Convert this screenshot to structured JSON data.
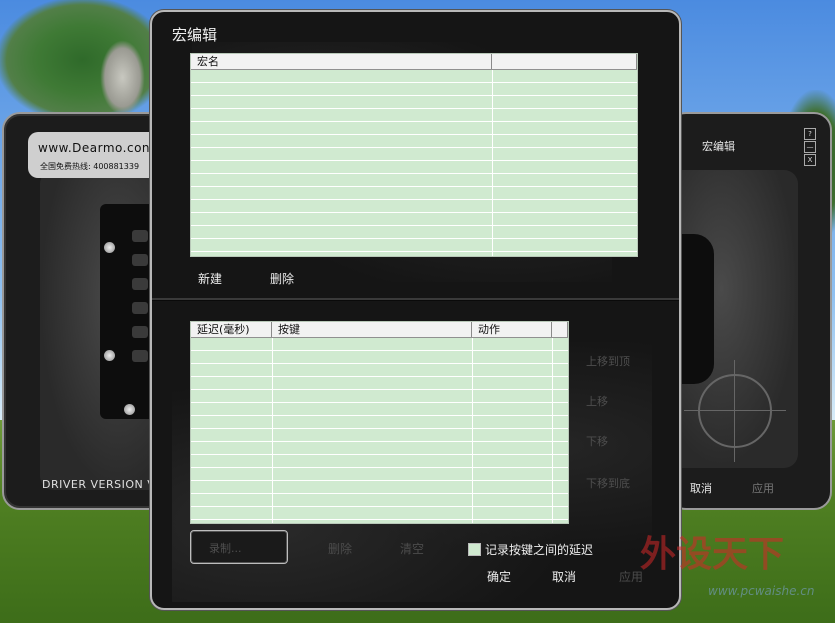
{
  "back_left": {
    "brand_url": "www.Dearmo.con",
    "hotline": "全国免费热线: 400881339",
    "driver_version": "DRIVER VERSION V"
  },
  "back_right": {
    "title": "宏编辑",
    "help": "?",
    "minimize": "—",
    "close": "X",
    "cancel": "取消",
    "apply": "应用"
  },
  "dialog": {
    "title": "宏编辑",
    "macro_list": {
      "columns": [
        "宏名",
        ""
      ],
      "rows": []
    },
    "new_label": "新建",
    "delete_label": "删除",
    "steps_list": {
      "columns": [
        "延迟(毫秒)",
        "按键",
        "动作",
        ""
      ],
      "rows": []
    },
    "move_top": "上移到顶",
    "move_up": "上移",
    "move_down": "下移",
    "move_bottom": "下移到底",
    "record": "录制...",
    "delete_step": "删除",
    "clear": "清空",
    "record_delay_checkbox": "记录按键之间的延迟",
    "record_delay_checked": false,
    "ok": "确定",
    "cancel": "取消",
    "apply": "应用"
  },
  "watermark": {
    "text": "外设天下",
    "url": "www.pcwaishe.cn"
  },
  "colors": {
    "grid_bg": "#d0ead0",
    "dialog_bg": "#151515",
    "enabled_text": "#eeeeee",
    "disabled_text": "#4c4c4c"
  }
}
